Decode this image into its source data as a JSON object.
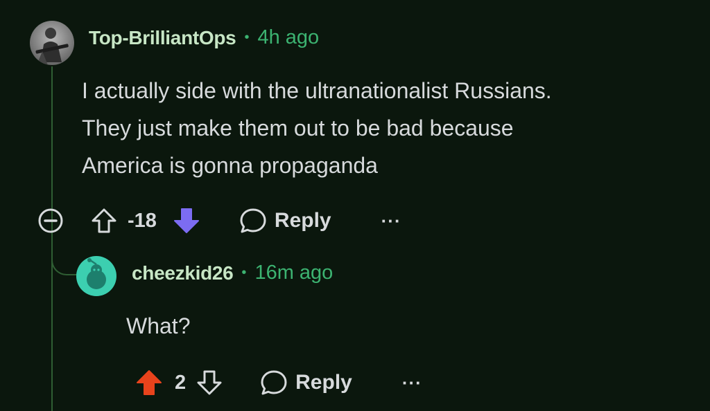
{
  "comment": {
    "username": "Top-BrilliantOps",
    "time": "4h ago",
    "body_lines": [
      "I actually side with the ultranationalist Russians.",
      "They just make them out to be bad because",
      "America is gonna propaganda"
    ],
    "score": "-18",
    "vote_state": "downvoted",
    "reply_label": "Reply",
    "more_label": "···"
  },
  "reply": {
    "username": "cheezkid26",
    "time": "16m ago",
    "body": "What?",
    "score": "2",
    "vote_state": "upvoted",
    "reply_label": "Reply",
    "more_label": "···"
  },
  "colors": {
    "background": "#0b170d",
    "thread_line": "#2f5e33",
    "timestamp": "#3cb371",
    "username": "#c7e6c5",
    "downvote_active": "#7c6cf2",
    "upvote_active": "#e8431c",
    "avatar_reply": "#3ccfb0"
  }
}
